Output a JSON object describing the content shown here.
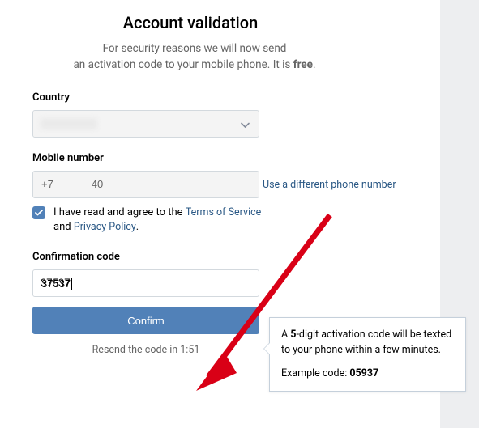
{
  "title": "Account validation",
  "subtitle_line1": "For security reasons we will now send",
  "subtitle_line2_a": "an activation code to your mobile phone. It is ",
  "subtitle_line2_b": "free",
  "subtitle_line2_c": ".",
  "country": {
    "label": "Country",
    "value": ""
  },
  "mobile": {
    "label": "Mobile number",
    "value": "+7             40",
    "different_link": "Use a different phone number"
  },
  "agree": {
    "text_a": "I have read and agree to the ",
    "tos": "Terms of Service",
    "text_b": " and ",
    "pp": "Privacy Policy",
    "text_c": "."
  },
  "confirmation": {
    "label": "Confirmation code",
    "value": "37537"
  },
  "confirm_button": "Confirm",
  "resend": {
    "prefix": "Resend the code in ",
    "time": "1:51"
  },
  "tooltip": {
    "line1_a": "A ",
    "line1_b": "5",
    "line1_c": "-digit activation code will be texted to your phone within a few minutes.",
    "example_a": "Example code: ",
    "example_b": "05937"
  }
}
